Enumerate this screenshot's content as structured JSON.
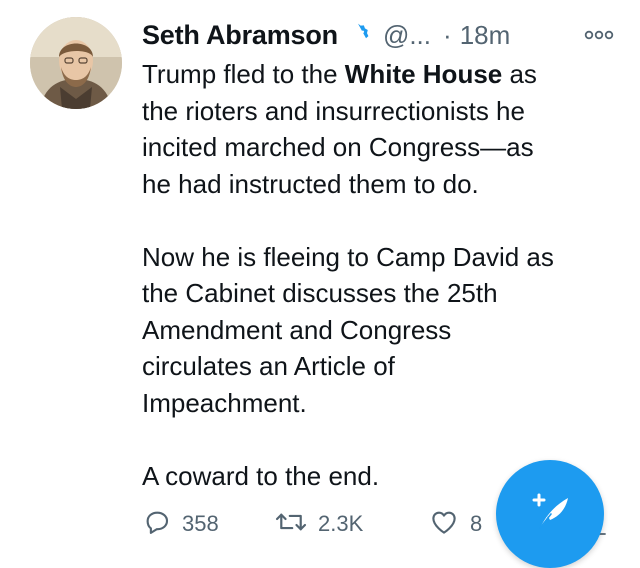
{
  "tweet": {
    "author_name": "Seth Abramson",
    "handle": "@...",
    "separator": "·",
    "time": "18m",
    "lines": {
      "l1_pre": "Trump fled to the ",
      "l1_bold": "White House",
      "l1_post": " as",
      "l2": "the rioters and insurrectionists he",
      "l3": "incited marched on Congress—as",
      "l4": "he had instructed them to do.",
      "l5": "Now he is fleeing to Camp David as",
      "l6": "the Cabinet discusses the 25th",
      "l7": "Amendment and Congress",
      "l8": "circulates an Article of",
      "l9": "Impeachment.",
      "l10": "A coward to the end."
    }
  },
  "actions": {
    "reply_count": "358",
    "retweet_count": "2.3K",
    "like_count": "8"
  },
  "colors": {
    "accent": "#1d9bf0",
    "muted": "#536471",
    "text": "#0f1419"
  },
  "icons": [
    "verified-badge-icon",
    "more-options-icon",
    "reply-icon",
    "retweet-icon",
    "like-icon",
    "compose-tweet-icon",
    "share-icon"
  ]
}
